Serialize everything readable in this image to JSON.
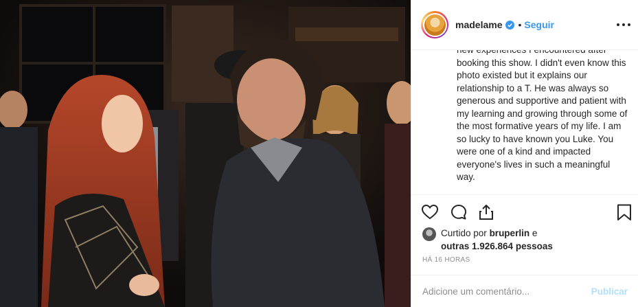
{
  "post": {
    "username": "madelame",
    "separator": "•",
    "follow_label": "Seguir",
    "caption": "new experiences I encountered after booking this show. I didn't even know this photo existed but it explains our relationship to a T. He was always so generous and supportive and patient with my learning and growing through some of the most formative years of my life. I am so lucky to have known you Luke. You were one of a kind and impacted everyone's lives in such a meaningful way.",
    "liked_by_prefix": "Curtido por",
    "liked_by_user": "bruperlin",
    "liked_by_conj": "e",
    "others_label": "outras 1.926.864 pessoas",
    "timestamp": "HÁ 16 HORAS",
    "comment_placeholder": "Adicione um comentário...",
    "publish_label": "Publicar"
  },
  "icons": {
    "verified": "verified-badge-icon",
    "more": "more-options-icon",
    "like": "heart-icon",
    "comment": "comment-bubble-icon",
    "share": "share-icon",
    "save": "bookmark-icon"
  },
  "colors": {
    "accent": "#3897f0",
    "publish_disabled": "#b2dffc",
    "muted": "#8e8e8e"
  }
}
